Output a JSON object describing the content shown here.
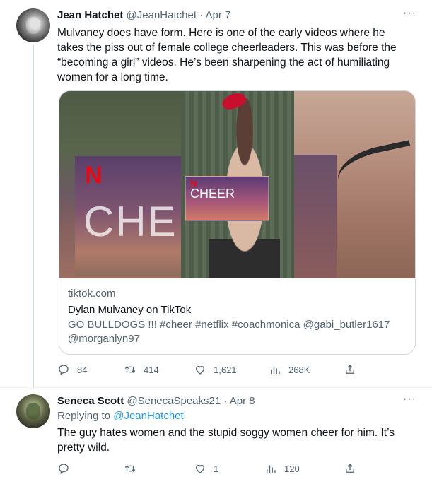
{
  "tweets": [
    {
      "name": "Jean Hatchet",
      "handle": "@JeanHatchet",
      "separator": "·",
      "date": "Apr 7",
      "more": "···",
      "text": "Mulvaney does have form. Here is one of the early videos where he takes the piss out of female college cheerleaders. This was before the “becoming a girl” videos. He’s been sharpening the act of humiliating women for a long time.",
      "card": {
        "media_logo": "N",
        "media_text_big": "CHE",
        "media_text_small": "CHEER",
        "domain": "tiktok.com",
        "title": "Dylan Mulvaney on TikTok",
        "description": "GO BULLDOGS !!! #cheer #netflix #coachmonica @gabi_butler1617 @morganlyn97"
      },
      "actions": {
        "replies": "84",
        "retweets": "414",
        "likes": "1,621",
        "views": "268K"
      }
    },
    {
      "name": "Seneca Scott",
      "handle": "@SenecaSpeaks21",
      "separator": "·",
      "date": "Apr 8",
      "more": "···",
      "replying_prefix": "Replying to",
      "replying_to": "@JeanHatchet",
      "text": "The guy hates women and the stupid soggy women cheer for him. It’s pretty wild.",
      "actions": {
        "replies": "",
        "retweets": "",
        "likes": "1",
        "views": "120"
      }
    }
  ],
  "icons": {
    "reply": "reply-icon",
    "retweet": "retweet-icon",
    "like": "heart-icon",
    "views": "views-icon",
    "share": "share-icon"
  },
  "colors": {
    "text": "#0f1419",
    "muted": "#536471",
    "link": "#1d9bf0",
    "border": "#cfd9de"
  }
}
